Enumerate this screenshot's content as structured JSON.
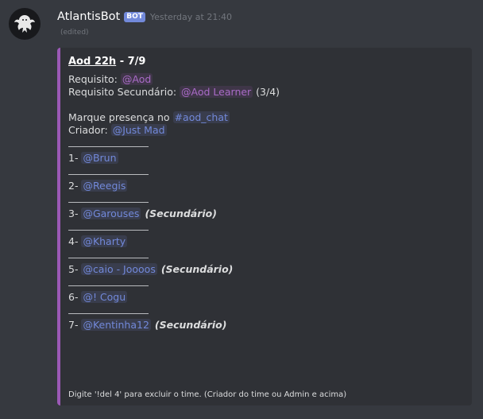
{
  "message": {
    "author": "AtlantisBot",
    "badge": "BOT",
    "timestamp": "Yesterday at 21:40",
    "edited": "(edited)"
  },
  "embed": {
    "accent_color": "#9b59b6",
    "title_link": "Aod 22h",
    "title_rest": " - 7/9",
    "req_label": "Requisito: ",
    "req_role": "@Aod",
    "req2_label": "Requisito Secundário: ",
    "req2_role": "@Aod Learner",
    "req2_count": " (3/4)",
    "presence_label": "Marque presença no ",
    "channel": "#aod_chat",
    "creator_label": "Criador: ",
    "creator": "@Just Mad",
    "separator": "________________",
    "participants": [
      {
        "num": "1- ",
        "name": "@Brun",
        "note": ""
      },
      {
        "num": "2- ",
        "name": "@Reegis",
        "note": ""
      },
      {
        "num": "3- ",
        "name": "@Garouses",
        "note": "(Secundário)"
      },
      {
        "num": "4- ",
        "name": "@Kharty",
        "note": ""
      },
      {
        "num": "5- ",
        "name": "@caio - Joooos",
        "note": "(Secundário)"
      },
      {
        "num": "6- ",
        "name": "@! Cogu",
        "note": ""
      },
      {
        "num": "7- ",
        "name": "@Kentinha12",
        "note": "(Secundário)"
      }
    ],
    "footer": "Digite '!del 4' para excluir o time. (Criador do time ou Admin e acima)"
  }
}
